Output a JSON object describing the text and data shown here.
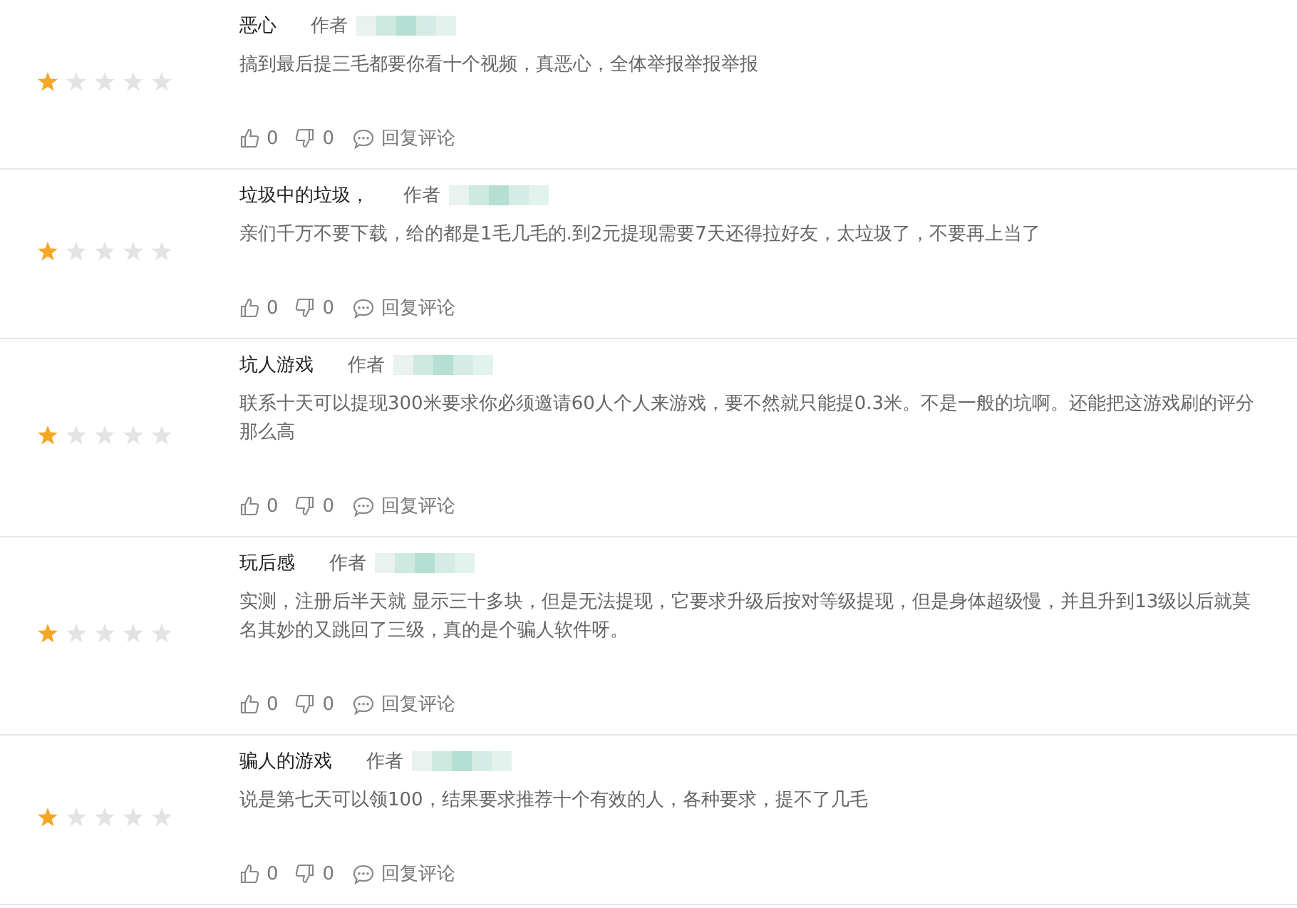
{
  "reviews": [
    {
      "title": "恶心",
      "author_label": "作者",
      "stars": 1,
      "body": "搞到最后提三毛都要你看十个视频，真恶心，全体举报举报举报",
      "likes": "0",
      "dislikes": "0",
      "reply": "回复评论"
    },
    {
      "title": "垃圾中的垃圾，",
      "author_label": "作者",
      "stars": 1,
      "body": "亲们千万不要下载，给的都是1毛几毛的.到2元提现需要7天还得拉好友，太垃圾了，不要再上当了",
      "likes": "0",
      "dislikes": "0",
      "reply": "回复评论"
    },
    {
      "title": "坑人游戏",
      "author_label": "作者",
      "stars": 1,
      "body": "联系十天可以提现300米要求你必须邀请60人个人来游戏，要不然就只能提0.3米。不是一般的坑啊。还能把这游戏刷的评分那么高",
      "likes": "0",
      "dislikes": "0",
      "reply": "回复评论"
    },
    {
      "title": "玩后感",
      "author_label": "作者",
      "stars": 1,
      "body": "实测，注册后半天就 显示三十多块，但是无法提现，它要求升级后按对等级提现，但是身体超级慢，并且升到13级以后就莫名其妙的又跳回了三级，真的是个骗人软件呀。",
      "likes": "0",
      "dislikes": "0",
      "reply": "回复评论"
    },
    {
      "title": "骗人的游戏",
      "author_label": "作者",
      "stars": 1,
      "body": "说是第七天可以领100，结果要求推荐十个有效的人，各种要求，提不了几毛",
      "likes": "0",
      "dislikes": "0",
      "reply": "回复评论"
    }
  ]
}
